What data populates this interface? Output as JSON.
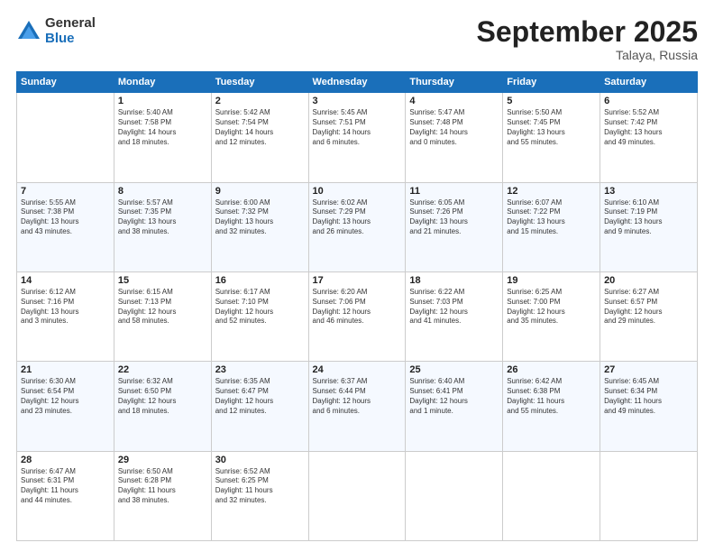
{
  "header": {
    "logo_general": "General",
    "logo_blue": "Blue",
    "month_title": "September 2025",
    "location": "Talaya, Russia"
  },
  "days_of_week": [
    "Sunday",
    "Monday",
    "Tuesday",
    "Wednesday",
    "Thursday",
    "Friday",
    "Saturday"
  ],
  "weeks": [
    [
      {
        "day": "",
        "content": ""
      },
      {
        "day": "1",
        "content": "Sunrise: 5:40 AM\nSunset: 7:58 PM\nDaylight: 14 hours\nand 18 minutes."
      },
      {
        "day": "2",
        "content": "Sunrise: 5:42 AM\nSunset: 7:54 PM\nDaylight: 14 hours\nand 12 minutes."
      },
      {
        "day": "3",
        "content": "Sunrise: 5:45 AM\nSunset: 7:51 PM\nDaylight: 14 hours\nand 6 minutes."
      },
      {
        "day": "4",
        "content": "Sunrise: 5:47 AM\nSunset: 7:48 PM\nDaylight: 14 hours\nand 0 minutes."
      },
      {
        "day": "5",
        "content": "Sunrise: 5:50 AM\nSunset: 7:45 PM\nDaylight: 13 hours\nand 55 minutes."
      },
      {
        "day": "6",
        "content": "Sunrise: 5:52 AM\nSunset: 7:42 PM\nDaylight: 13 hours\nand 49 minutes."
      }
    ],
    [
      {
        "day": "7",
        "content": "Sunrise: 5:55 AM\nSunset: 7:38 PM\nDaylight: 13 hours\nand 43 minutes."
      },
      {
        "day": "8",
        "content": "Sunrise: 5:57 AM\nSunset: 7:35 PM\nDaylight: 13 hours\nand 38 minutes."
      },
      {
        "day": "9",
        "content": "Sunrise: 6:00 AM\nSunset: 7:32 PM\nDaylight: 13 hours\nand 32 minutes."
      },
      {
        "day": "10",
        "content": "Sunrise: 6:02 AM\nSunset: 7:29 PM\nDaylight: 13 hours\nand 26 minutes."
      },
      {
        "day": "11",
        "content": "Sunrise: 6:05 AM\nSunset: 7:26 PM\nDaylight: 13 hours\nand 21 minutes."
      },
      {
        "day": "12",
        "content": "Sunrise: 6:07 AM\nSunset: 7:22 PM\nDaylight: 13 hours\nand 15 minutes."
      },
      {
        "day": "13",
        "content": "Sunrise: 6:10 AM\nSunset: 7:19 PM\nDaylight: 13 hours\nand 9 minutes."
      }
    ],
    [
      {
        "day": "14",
        "content": "Sunrise: 6:12 AM\nSunset: 7:16 PM\nDaylight: 13 hours\nand 3 minutes."
      },
      {
        "day": "15",
        "content": "Sunrise: 6:15 AM\nSunset: 7:13 PM\nDaylight: 12 hours\nand 58 minutes."
      },
      {
        "day": "16",
        "content": "Sunrise: 6:17 AM\nSunset: 7:10 PM\nDaylight: 12 hours\nand 52 minutes."
      },
      {
        "day": "17",
        "content": "Sunrise: 6:20 AM\nSunset: 7:06 PM\nDaylight: 12 hours\nand 46 minutes."
      },
      {
        "day": "18",
        "content": "Sunrise: 6:22 AM\nSunset: 7:03 PM\nDaylight: 12 hours\nand 41 minutes."
      },
      {
        "day": "19",
        "content": "Sunrise: 6:25 AM\nSunset: 7:00 PM\nDaylight: 12 hours\nand 35 minutes."
      },
      {
        "day": "20",
        "content": "Sunrise: 6:27 AM\nSunset: 6:57 PM\nDaylight: 12 hours\nand 29 minutes."
      }
    ],
    [
      {
        "day": "21",
        "content": "Sunrise: 6:30 AM\nSunset: 6:54 PM\nDaylight: 12 hours\nand 23 minutes."
      },
      {
        "day": "22",
        "content": "Sunrise: 6:32 AM\nSunset: 6:50 PM\nDaylight: 12 hours\nand 18 minutes."
      },
      {
        "day": "23",
        "content": "Sunrise: 6:35 AM\nSunset: 6:47 PM\nDaylight: 12 hours\nand 12 minutes."
      },
      {
        "day": "24",
        "content": "Sunrise: 6:37 AM\nSunset: 6:44 PM\nDaylight: 12 hours\nand 6 minutes."
      },
      {
        "day": "25",
        "content": "Sunrise: 6:40 AM\nSunset: 6:41 PM\nDaylight: 12 hours\nand 1 minute."
      },
      {
        "day": "26",
        "content": "Sunrise: 6:42 AM\nSunset: 6:38 PM\nDaylight: 11 hours\nand 55 minutes."
      },
      {
        "day": "27",
        "content": "Sunrise: 6:45 AM\nSunset: 6:34 PM\nDaylight: 11 hours\nand 49 minutes."
      }
    ],
    [
      {
        "day": "28",
        "content": "Sunrise: 6:47 AM\nSunset: 6:31 PM\nDaylight: 11 hours\nand 44 minutes."
      },
      {
        "day": "29",
        "content": "Sunrise: 6:50 AM\nSunset: 6:28 PM\nDaylight: 11 hours\nand 38 minutes."
      },
      {
        "day": "30",
        "content": "Sunrise: 6:52 AM\nSunset: 6:25 PM\nDaylight: 11 hours\nand 32 minutes."
      },
      {
        "day": "",
        "content": ""
      },
      {
        "day": "",
        "content": ""
      },
      {
        "day": "",
        "content": ""
      },
      {
        "day": "",
        "content": ""
      }
    ]
  ]
}
